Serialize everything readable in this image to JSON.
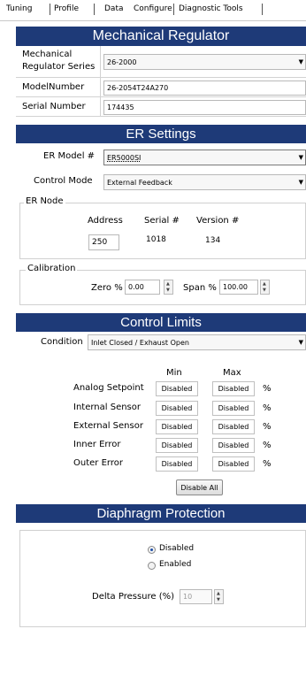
{
  "tabs": [
    {
      "label": "Tuning"
    },
    {
      "label": "Profile"
    },
    {
      "label": "Data"
    },
    {
      "label": "Configure"
    },
    {
      "label": "Diagnostic Tools"
    }
  ],
  "mechanical_regulator": {
    "header": "Mechanical Regulator",
    "series_label_line1": "Mechanical",
    "series_label_line2": "Regulator Series",
    "series_value": "26-2000",
    "model_label": "ModelNumber",
    "model_value": "26-2054T24A270",
    "serial_label": "Serial Number",
    "serial_value": "174435"
  },
  "er_settings": {
    "header": "ER Settings",
    "model_label": "ER Model #",
    "model_value": "ER5000SI",
    "control_mode_label": "Control Mode",
    "control_mode_value": "External Feedback",
    "node_title": "ER Node",
    "address_label": "Address",
    "serial_label": "Serial #",
    "version_label": "Version #",
    "address_value": "250",
    "serial_value": "1018",
    "version_value": "134",
    "calibration_title": "Calibration",
    "zero_label": "Zero %",
    "zero_value": "0.00",
    "span_label": "Span %",
    "span_value": "100.00"
  },
  "control_limits": {
    "header": "Control Limits",
    "condition_label": "Condition",
    "condition_value": "Inlet Closed / Exhaust Open",
    "min_header": "Min",
    "max_header": "Max",
    "rows": [
      {
        "label": "Analog Setpoint",
        "min": "Disabled",
        "max": "Disabled",
        "unit": "%"
      },
      {
        "label": "Internal Sensor",
        "min": "Disabled",
        "max": "Disabled",
        "unit": "%"
      },
      {
        "label": "External Sensor",
        "min": "Disabled",
        "max": "Disabled",
        "unit": "%"
      },
      {
        "label": "Inner Error",
        "min": "Disabled",
        "max": "Disabled",
        "unit": "%"
      },
      {
        "label": "Outer Error",
        "min": "Disabled",
        "max": "Disabled",
        "unit": "%"
      }
    ],
    "disable_all_label": "Disable All"
  },
  "diaphragm_protection": {
    "header": "Diaphragm Protection",
    "option_disabled": "Disabled",
    "option_enabled": "Enabled",
    "selected": "Disabled",
    "delta_label": "Delta Pressure (%)",
    "delta_value": "10"
  },
  "icons": {
    "dropdown_arrow": "chevron-down-icon",
    "spinner": "spinner-arrows-icon"
  },
  "colors": {
    "header_bg": "#1e3a78",
    "header_text": "#ffffff",
    "radio_selected": "#1d4ea8"
  }
}
